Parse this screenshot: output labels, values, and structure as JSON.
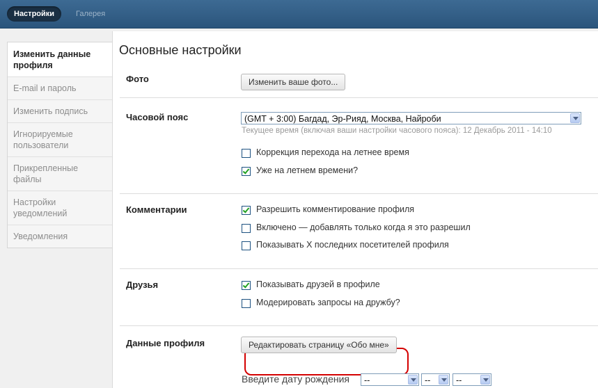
{
  "topbar": {
    "tab_settings": "Настройки",
    "tab_gallery": "Галерея"
  },
  "sidebar": {
    "items": [
      {
        "label": "Изменить данные профиля"
      },
      {
        "label": "E-mail и пароль"
      },
      {
        "label": "Изменить подпись"
      },
      {
        "label": "Игнорируемые пользователи"
      },
      {
        "label": "Прикрепленные файлы"
      },
      {
        "label": "Настройки уведомлений"
      },
      {
        "label": "Уведомления"
      }
    ]
  },
  "main": {
    "title": "Основные настройки",
    "photo": {
      "label": "Фото",
      "button": "Изменить ваше фото..."
    },
    "timezone": {
      "label": "Часовой пояс",
      "selected": "(GMT + 3:00) Багдад, Эр-Рияд, Москва, Найроби",
      "hint": "Текущее время (включая ваши настройки часового пояса): 12 Декабрь 2011 - 14:10",
      "options": [
        {
          "label": "Коррекция перехода на летнее время",
          "checked": false
        },
        {
          "label": "Уже на летнем времени?",
          "checked": true
        }
      ]
    },
    "comments": {
      "label": "Комментарии",
      "options": [
        {
          "label": "Разрешить комментирование профиля",
          "checked": true
        },
        {
          "label": "Включено — добавлять только когда я это разрешил",
          "checked": false
        },
        {
          "label": "Показывать X последних посетителей профиля",
          "checked": false
        }
      ]
    },
    "friends": {
      "label": "Друзья",
      "options": [
        {
          "label": "Показывать друзей в профиле",
          "checked": true
        },
        {
          "label": "Модерировать запросы на дружбу?",
          "checked": false
        }
      ]
    },
    "profile_data": {
      "label": "Данные профиля",
      "button": "Редактировать страницу «Обо мне»",
      "birthdate_label": "Введите дату рождения",
      "birth_day": "--",
      "birth_month": "--",
      "birth_year": "--"
    }
  },
  "colors": {
    "topbar": "#2b557c",
    "highlight": "#d40000",
    "check": "#21a121"
  }
}
